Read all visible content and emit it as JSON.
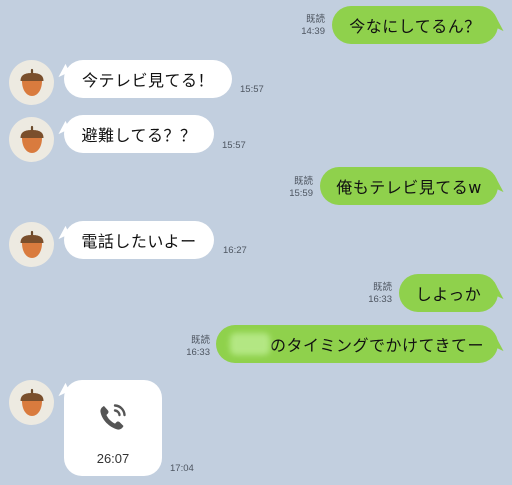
{
  "messages": [
    {
      "dir": "out",
      "text": "今なにしてるん？",
      "read": "既読",
      "time": "14:39"
    },
    {
      "dir": "in",
      "text": "今テレビ見てる！",
      "time": "15:57"
    },
    {
      "dir": "in",
      "text": "避難してる？？",
      "time": "15:57"
    },
    {
      "dir": "out",
      "text": "俺もテレビ見てるw",
      "read": "既読",
      "time": "15:59"
    },
    {
      "dir": "in",
      "text": "電話したいよー",
      "time": "16:27"
    },
    {
      "dir": "out",
      "text": "しよっか",
      "read": "既読",
      "time": "16:33"
    },
    {
      "dir": "out",
      "text": "のタイミングでかけてきてー",
      "read": "既読",
      "time": "16:33"
    },
    {
      "dir": "in",
      "call_duration": "26:07",
      "time": "17:04"
    }
  ],
  "icons": {
    "avatar": "acorn-icon",
    "call": "phone-call-icon"
  },
  "colors": {
    "background": "#c2cfdf",
    "outgoing_bubble": "#8fd14c",
    "incoming_bubble": "#ffffff"
  }
}
